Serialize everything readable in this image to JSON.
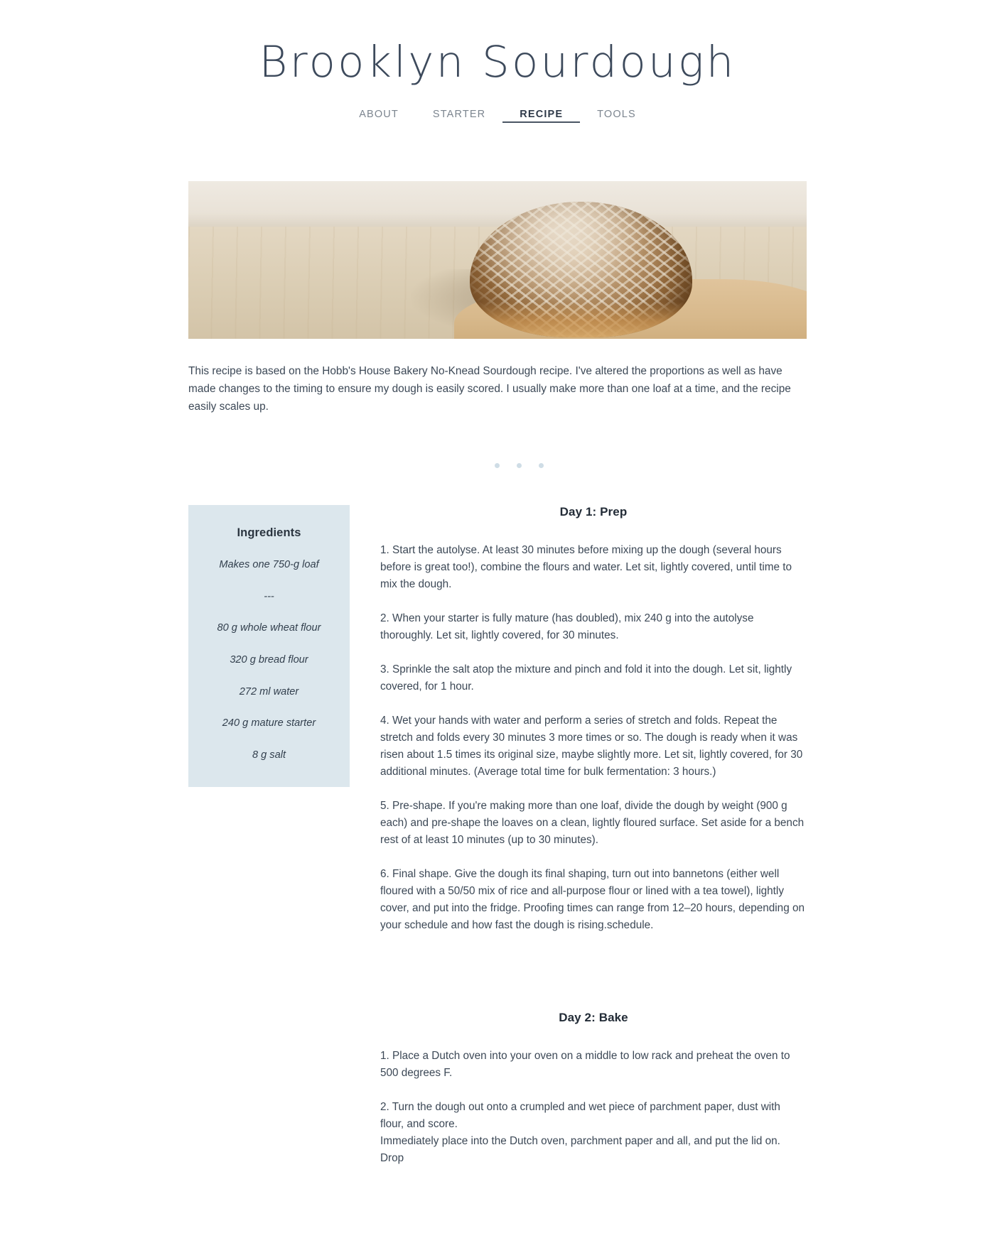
{
  "site": {
    "title": "Brooklyn Sourdough"
  },
  "nav": {
    "items": [
      {
        "label": "ABOUT",
        "active": false
      },
      {
        "label": "STARTER",
        "active": false
      },
      {
        "label": "RECIPE",
        "active": true
      },
      {
        "label": "TOOLS",
        "active": false
      }
    ]
  },
  "hero": {
    "alt": "Scored sourdough boule resting on a wooden peel"
  },
  "intro": {
    "text": "This recipe is based on the Hobb's House Bakery No-Knead Sourdough recipe. I've altered the proportions as well as have made changes to the timing to ensure my dough is easily scored. I usually make more than one loaf at a time, and the recipe easily scales up."
  },
  "divider": {
    "dot_count": 3,
    "dot_color": "#cfdde6"
  },
  "ingredients": {
    "title": "Ingredients",
    "lines": [
      "Makes one 750-g loaf",
      "---",
      "80 g whole wheat flour",
      "320 g bread flour",
      "272 ml water",
      "240 g mature starter",
      "8 g salt"
    ]
  },
  "day_one": {
    "heading": "Day 1: Prep",
    "steps": [
      "1. Start the autolyse. At least 30 minutes before mixing up the dough (several hours before is great too!), combine the flours and water. Let sit, lightly covered, until time to mix the dough.",
      "2. When your starter is fully mature (has doubled), mix 240 g into the autolyse thoroughly. Let sit, lightly covered, for 30 minutes.",
      "3. Sprinkle the salt atop the mixture and pinch and fold it into the dough. Let sit, lightly covered, for 1 hour.",
      "4. Wet your hands with water and perform a series of stretch and folds. Repeat the stretch and folds every 30 minutes 3 more times or so. The dough is ready when it was risen about 1.5 times its original size, maybe slightly more. Let sit, lightly covered, for 30 additional minutes. (Average total time for bulk fermentation: 3 hours.)",
      "5. Pre-shape. If you're making more than one loaf, divide the dough by weight (900 g each) and pre-shape the loaves on a clean, lightly floured surface. Set aside for a bench rest of at least 10 minutes (up to 30 minutes).",
      "6. Final shape. Give the dough its final shaping, turn out into bannetons (either well floured with a 50/50 mix of rice and all-purpose flour or lined with a tea towel), lightly cover, and put into the fridge. Proofing times can range from 12–20 hours, depending on your schedule and how fast the dough is rising.schedule."
    ]
  },
  "day_two": {
    "heading": "Day 2: Bake",
    "steps": [
      "1. Place a Dutch oven into your oven on a middle to low rack and preheat the oven to 500 degrees F.",
      "2. Turn the dough out onto a crumpled and wet piece of parchment paper, dust with flour, and score.\nImmediately place into the Dutch oven, parchment paper and all, and put the lid on. Drop"
    ]
  },
  "colors": {
    "title_slate": "#3d4a5c",
    "body_text": "#3c4856",
    "nav_inactive": "#7c858f",
    "nav_active": "#2f3a49",
    "card_background": "#dce7ed",
    "dot": "#cfdde6"
  }
}
